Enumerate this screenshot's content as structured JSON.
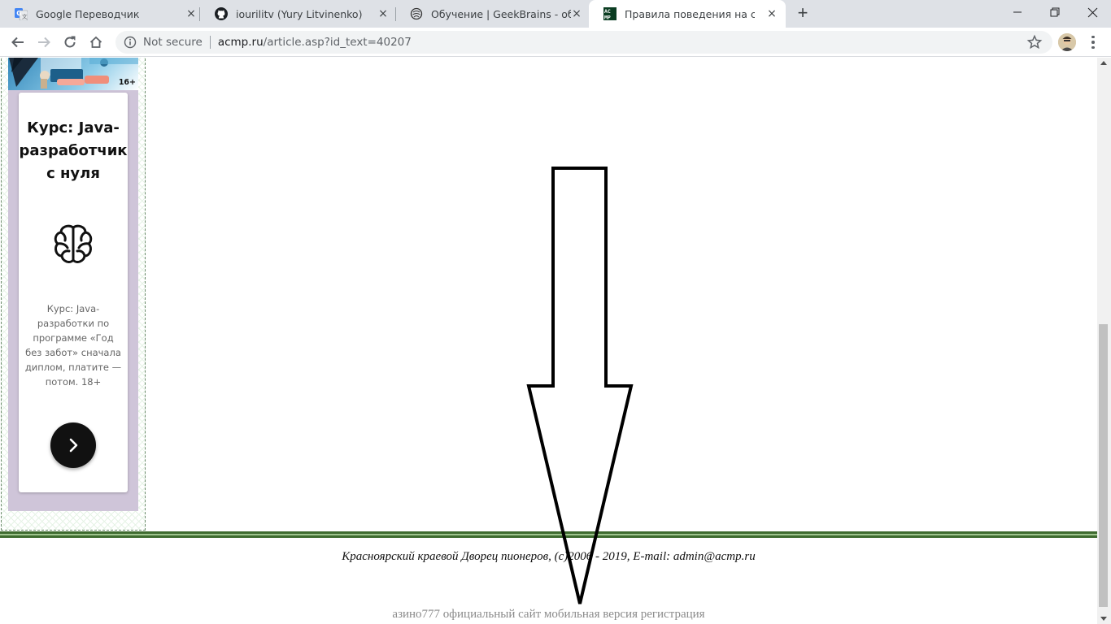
{
  "tabs": [
    {
      "title": "Google Переводчик",
      "icon": "google-translate-icon",
      "close": "×"
    },
    {
      "title": "iourilitv (Yury Litvinenko)",
      "icon": "github-icon",
      "close": "×"
    },
    {
      "title": "Обучение | GeekBrains - образо",
      "icon": "geekbrains-icon",
      "close": "×"
    },
    {
      "title": "Правила поведения на сайте",
      "icon": "acmp-icon",
      "close": "×",
      "active": true
    }
  ],
  "new_tab": "+",
  "address": {
    "security": "Not secure",
    "host": "acmp.ru",
    "path": "/article.asp?id_text=40207"
  },
  "ad": {
    "age": "16+",
    "title": "Курс: Java-разработчик с нуля",
    "description": "Курс: Java-разработки по программе «Год без забот» сначала диплом, платите — потом. 18+"
  },
  "footer": {
    "copyright": "Красноярский краевой Дворец пионеров, (c)2006 - 2019, E-mail: admin@acmp.ru",
    "spam_link": "азино777 официальный сайт мобильная версия регистрация"
  },
  "colors": {
    "tabstrip": "#dee1e6",
    "rule_dark": "#3e6b2f",
    "rule_light": "#9fc48e",
    "ad_background": "#cfc5d9"
  }
}
